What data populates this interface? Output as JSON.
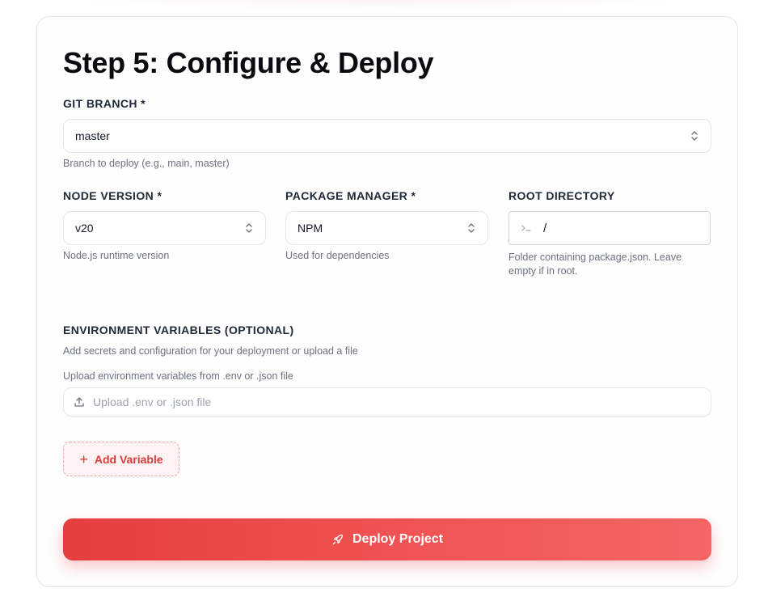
{
  "page": {
    "title": "Step 5: Configure & Deploy"
  },
  "git_branch": {
    "label": "GIT BRANCH *",
    "value": "master",
    "hint": "Branch to deploy (e.g., main, master)"
  },
  "node_version": {
    "label": "NODE VERSION *",
    "value": "v20",
    "hint": "Node.js runtime version"
  },
  "package_manager": {
    "label": "PACKAGE MANAGER *",
    "value": "NPM",
    "hint": "Used for dependencies"
  },
  "root_directory": {
    "label": "ROOT DIRECTORY",
    "value": "/",
    "hint": "Folder containing package.json. Leave empty if in root."
  },
  "env": {
    "label": "ENVIRONMENT VARIABLES (OPTIONAL)",
    "description": "Add secrets and configuration for your deployment or upload a file",
    "upload_label": "Upload environment variables from .env or .json file",
    "upload_placeholder": "Upload .env or .json file",
    "add_label": "Add Variable"
  },
  "deploy": {
    "label": "Deploy Project"
  },
  "colors": {
    "accent": "#e53e3e",
    "accent_light": "#fef2f2"
  },
  "icons": {
    "select_chevron": "chevron-up-down-icon",
    "root_prefix": "terminal-icon",
    "upload": "upload-icon",
    "add": "plus-icon",
    "deploy": "rocket-icon"
  }
}
